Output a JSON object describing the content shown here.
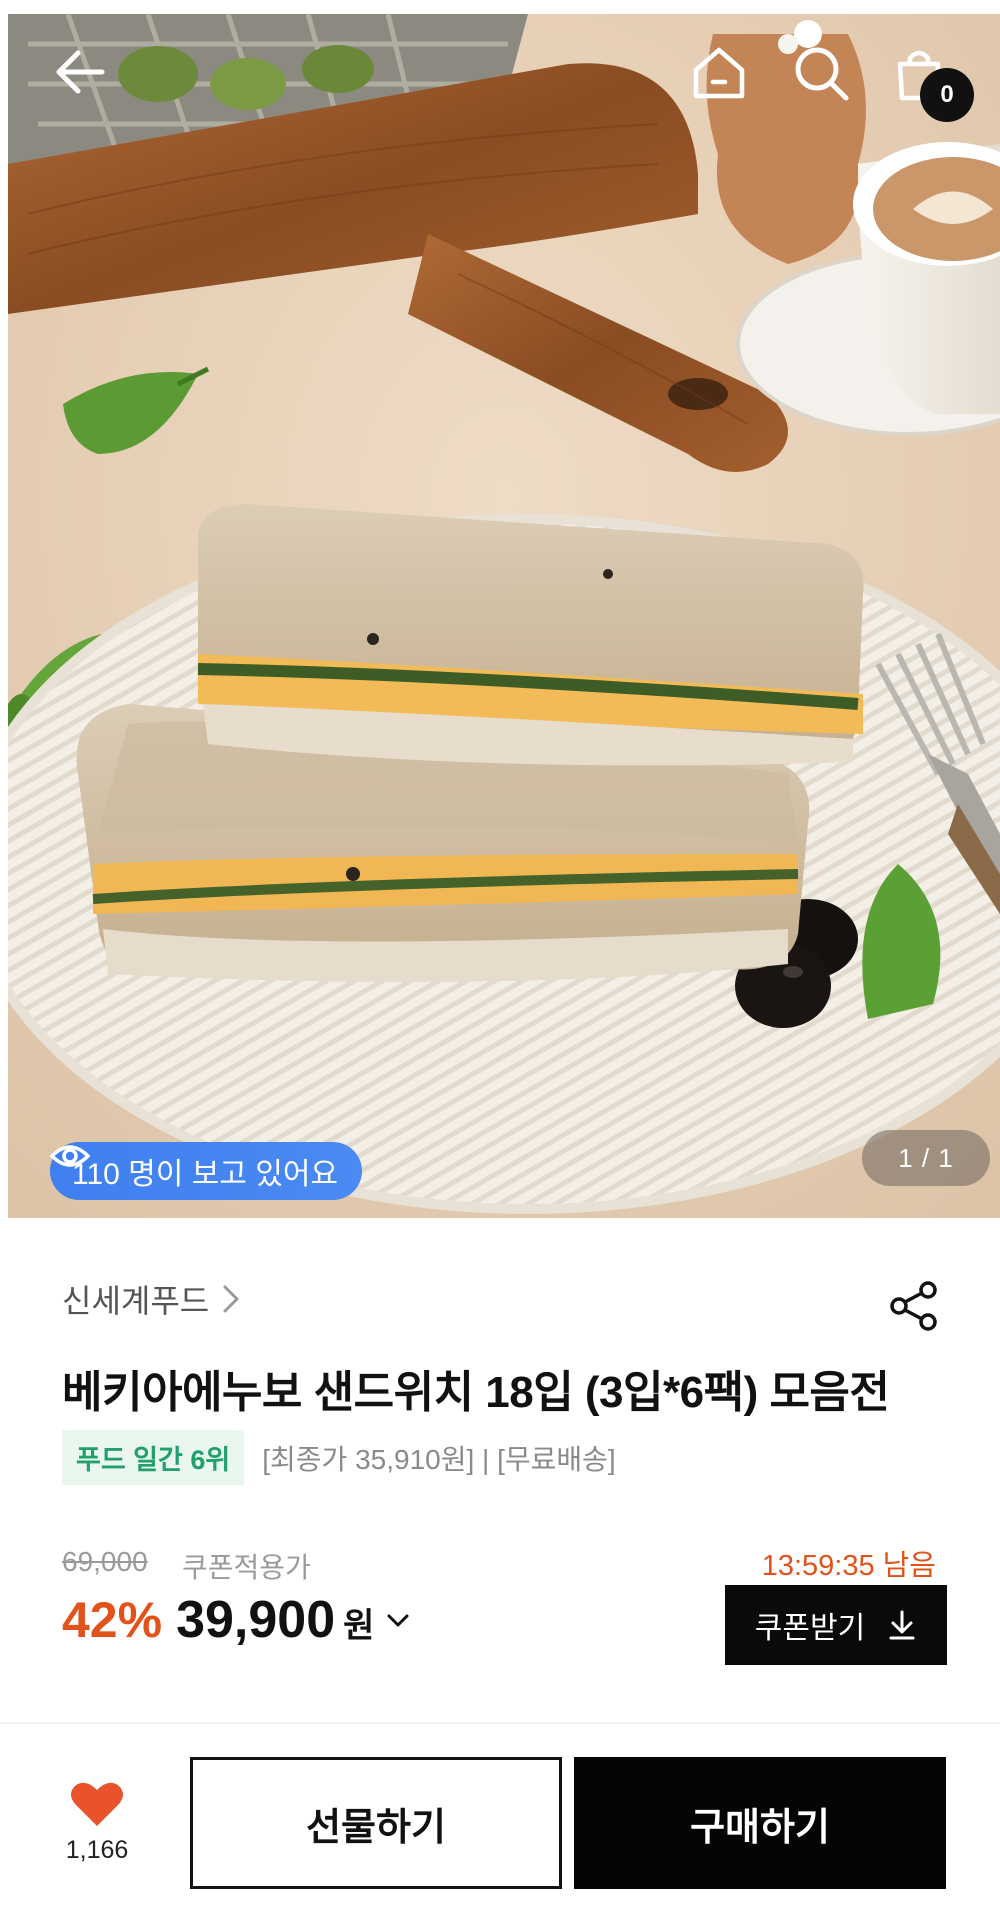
{
  "hero": {
    "cart_count": "0",
    "viewers_text": "110 명이 보고 있어요",
    "image_counter": "1 / 1"
  },
  "product": {
    "brand": "신세계푸드",
    "title": "베키아에누보 샌드위치 18입 (3입*6팩) 모음전",
    "rank_badge": "푸드 일간 6위",
    "meta": "[최종가 35,910원] | [무료배송]"
  },
  "pricing": {
    "original_price": "69,000",
    "coupon_label": "쿠폰적용가",
    "discount": "42%",
    "final_price": "39,900",
    "currency": "원",
    "timer": "13:59:35 남음",
    "coupon_button": "쿠폰받기"
  },
  "bottom_bar": {
    "like_count": "1,166",
    "gift_label": "선물하기",
    "buy_label": "구매하기"
  },
  "colors": {
    "accent": "#e2521b",
    "viewer_pill": "#3f7ff0",
    "rank_badge_text": "#22a06b",
    "heart": "#e8532b"
  },
  "icons": [
    "back-arrow-icon",
    "home-icon",
    "search-icon",
    "cart-icon",
    "eye-icon",
    "chevron-right-icon",
    "share-icon",
    "chevron-down-icon",
    "download-icon",
    "heart-icon"
  ]
}
